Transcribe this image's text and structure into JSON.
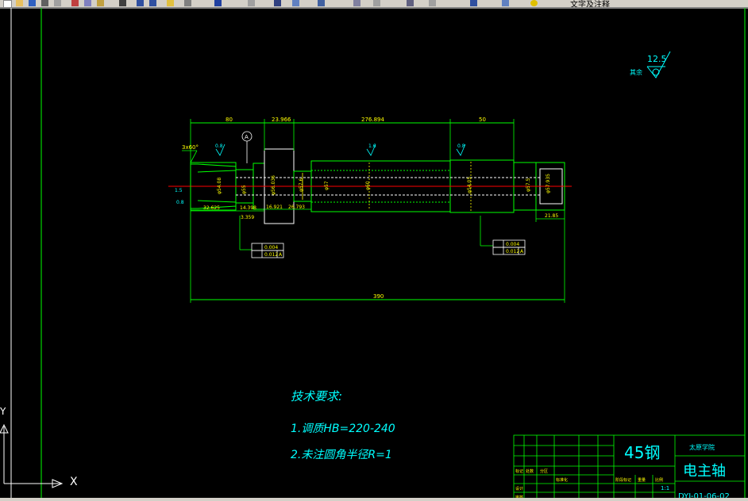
{
  "toolbar": {
    "icons": [
      "new-icon",
      "open-icon",
      "save-icon",
      "print-icon",
      "preview-icon",
      "cut-icon",
      "copy-icon",
      "paste-icon",
      "match-icon",
      "undo-icon",
      "redo-icon",
      "pan-icon",
      "zoom-icon",
      "zoom-window-icon",
      "zoom-prev-icon",
      "properties-icon",
      "design-center-icon",
      "tool-palette-icon",
      "sheet-set-icon",
      "markup-icon",
      "calc-icon",
      "help-icon",
      "layer-icon",
      "layer-state-icon",
      "layer-prev-icon"
    ],
    "layer_name": "文字及注释"
  },
  "colors": {
    "background": "#000000",
    "frame": "#00ff00",
    "dimension": "#00ff00",
    "outline": "#ffffff",
    "centerline": "#ff0000",
    "text": "#00ffff",
    "yellow": "#ffff00"
  },
  "surface_roughness": {
    "symbol_value": "12.5",
    "label": "其余"
  },
  "dimensions": {
    "d80": "80",
    "d23": "23.966",
    "d276": "276.894",
    "d50": "50",
    "d390": "390",
    "d2185": "21.85",
    "d32625": "32.625",
    "d14": "14.398",
    "d16921": "16.921",
    "d26793": "26.793",
    "d3359": "3.359",
    "chamfer": "3x60°",
    "angle15": "1.5",
    "angle16": "1.6",
    "r08a": "0.8",
    "r16": "1.6",
    "r08b": "0.8",
    "dia1": "φ54.08",
    "dia2": "φ55",
    "dia3": "φ56.036",
    "dia4": "φ57.6",
    "dia5": "φ57",
    "dia6": "φ60",
    "dia7": "φ54.05",
    "dia8": "φ57.5",
    "dia9": "φ57.935",
    "datum": "A"
  },
  "tolerance_left": {
    "row1_val": "0.004",
    "row2_val": "0.012",
    "row2_ref": "A"
  },
  "tolerance_right": {
    "row1_val": "0.004",
    "row2_val": "0.012",
    "row2_ref": "A"
  },
  "tech_requirements": {
    "title": "技术要求:",
    "line1": "1.调质HB=220-240",
    "line2": "2.未注圆角半径R=1"
  },
  "title_block": {
    "material": "45钢",
    "school": "太原学院",
    "part_name": "电主轴",
    "drawing_no": "DYJ-01-06-02",
    "scale": "1:1",
    "sign": "标记",
    "count": "处数",
    "zone": "分区",
    "design": "设计",
    "check": "审核",
    "standard": "标准化",
    "stage": "阶段标记",
    "weight": "重量",
    "ratio": "比例"
  },
  "ucs": {
    "x": "X",
    "y": "Y"
  }
}
